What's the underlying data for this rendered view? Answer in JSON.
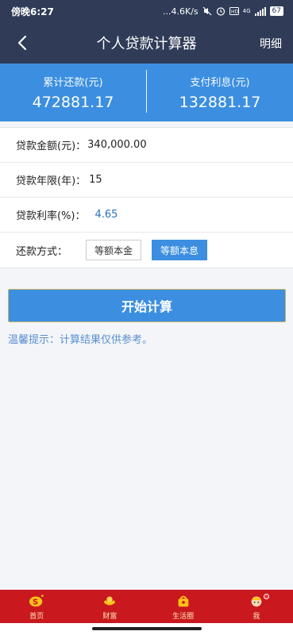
{
  "status_bar": {
    "time": "傍晚6:27",
    "network_speed": "...4.6K/s",
    "signal": "4G",
    "battery": "67"
  },
  "nav": {
    "title": "个人贷款计算器",
    "detail": "明细",
    "back_icon": "chevron-left-icon"
  },
  "summary": {
    "total_label": "累计还款(元)",
    "total_value": "472881.17",
    "interest_label": "支付利息(元)",
    "interest_value": "132881.17"
  },
  "form": {
    "amount_label": "贷款金额(元)：",
    "amount_value": "340,000.00",
    "term_label": "贷款年限(年)：",
    "term_value": "15",
    "rate_label": "贷款利率(%)：",
    "rate_value": "4.65",
    "method_label": "还款方式：",
    "method_options": [
      "等额本金",
      "等额本息"
    ],
    "method_selected": "等额本息"
  },
  "actions": {
    "calculate_label": "开始计算"
  },
  "tip": "温馨提示：计算结果仅供参考。",
  "tabs": [
    {
      "label": "首页",
      "icon": "home-logo-icon"
    },
    {
      "label": "财富",
      "icon": "gold-ingot-icon"
    },
    {
      "label": "生活圈",
      "icon": "life-circle-icon"
    },
    {
      "label": "我",
      "icon": "profile-avatar-icon"
    }
  ],
  "colors": {
    "header": "#2f3b57",
    "accent": "#3c8fe0",
    "tab_bar": "#c9181e"
  }
}
